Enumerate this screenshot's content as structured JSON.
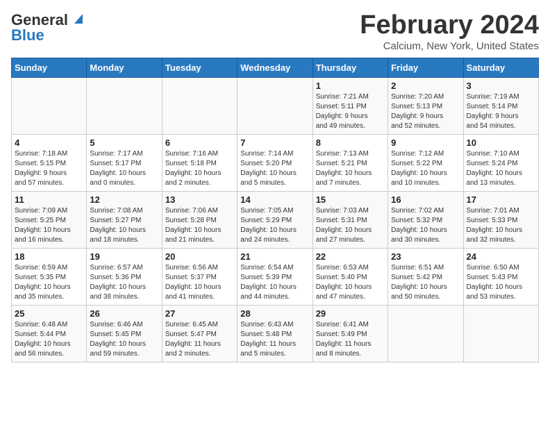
{
  "logo": {
    "general": "General",
    "blue": "Blue"
  },
  "header": {
    "title": "February 2024",
    "subtitle": "Calcium, New York, United States"
  },
  "days_of_week": [
    "Sunday",
    "Monday",
    "Tuesday",
    "Wednesday",
    "Thursday",
    "Friday",
    "Saturday"
  ],
  "weeks": [
    [
      {
        "day": "",
        "info": ""
      },
      {
        "day": "",
        "info": ""
      },
      {
        "day": "",
        "info": ""
      },
      {
        "day": "",
        "info": ""
      },
      {
        "day": "1",
        "info": "Sunrise: 7:21 AM\nSunset: 5:11 PM\nDaylight: 9 hours\nand 49 minutes."
      },
      {
        "day": "2",
        "info": "Sunrise: 7:20 AM\nSunset: 5:13 PM\nDaylight: 9 hours\nand 52 minutes."
      },
      {
        "day": "3",
        "info": "Sunrise: 7:19 AM\nSunset: 5:14 PM\nDaylight: 9 hours\nand 54 minutes."
      }
    ],
    [
      {
        "day": "4",
        "info": "Sunrise: 7:18 AM\nSunset: 5:15 PM\nDaylight: 9 hours\nand 57 minutes."
      },
      {
        "day": "5",
        "info": "Sunrise: 7:17 AM\nSunset: 5:17 PM\nDaylight: 10 hours\nand 0 minutes."
      },
      {
        "day": "6",
        "info": "Sunrise: 7:16 AM\nSunset: 5:18 PM\nDaylight: 10 hours\nand 2 minutes."
      },
      {
        "day": "7",
        "info": "Sunrise: 7:14 AM\nSunset: 5:20 PM\nDaylight: 10 hours\nand 5 minutes."
      },
      {
        "day": "8",
        "info": "Sunrise: 7:13 AM\nSunset: 5:21 PM\nDaylight: 10 hours\nand 7 minutes."
      },
      {
        "day": "9",
        "info": "Sunrise: 7:12 AM\nSunset: 5:22 PM\nDaylight: 10 hours\nand 10 minutes."
      },
      {
        "day": "10",
        "info": "Sunrise: 7:10 AM\nSunset: 5:24 PM\nDaylight: 10 hours\nand 13 minutes."
      }
    ],
    [
      {
        "day": "11",
        "info": "Sunrise: 7:09 AM\nSunset: 5:25 PM\nDaylight: 10 hours\nand 16 minutes."
      },
      {
        "day": "12",
        "info": "Sunrise: 7:08 AM\nSunset: 5:27 PM\nDaylight: 10 hours\nand 18 minutes."
      },
      {
        "day": "13",
        "info": "Sunrise: 7:06 AM\nSunset: 5:28 PM\nDaylight: 10 hours\nand 21 minutes."
      },
      {
        "day": "14",
        "info": "Sunrise: 7:05 AM\nSunset: 5:29 PM\nDaylight: 10 hours\nand 24 minutes."
      },
      {
        "day": "15",
        "info": "Sunrise: 7:03 AM\nSunset: 5:31 PM\nDaylight: 10 hours\nand 27 minutes."
      },
      {
        "day": "16",
        "info": "Sunrise: 7:02 AM\nSunset: 5:32 PM\nDaylight: 10 hours\nand 30 minutes."
      },
      {
        "day": "17",
        "info": "Sunrise: 7:01 AM\nSunset: 5:33 PM\nDaylight: 10 hours\nand 32 minutes."
      }
    ],
    [
      {
        "day": "18",
        "info": "Sunrise: 6:59 AM\nSunset: 5:35 PM\nDaylight: 10 hours\nand 35 minutes."
      },
      {
        "day": "19",
        "info": "Sunrise: 6:57 AM\nSunset: 5:36 PM\nDaylight: 10 hours\nand 38 minutes."
      },
      {
        "day": "20",
        "info": "Sunrise: 6:56 AM\nSunset: 5:37 PM\nDaylight: 10 hours\nand 41 minutes."
      },
      {
        "day": "21",
        "info": "Sunrise: 6:54 AM\nSunset: 5:39 PM\nDaylight: 10 hours\nand 44 minutes."
      },
      {
        "day": "22",
        "info": "Sunrise: 6:53 AM\nSunset: 5:40 PM\nDaylight: 10 hours\nand 47 minutes."
      },
      {
        "day": "23",
        "info": "Sunrise: 6:51 AM\nSunset: 5:42 PM\nDaylight: 10 hours\nand 50 minutes."
      },
      {
        "day": "24",
        "info": "Sunrise: 6:50 AM\nSunset: 5:43 PM\nDaylight: 10 hours\nand 53 minutes."
      }
    ],
    [
      {
        "day": "25",
        "info": "Sunrise: 6:48 AM\nSunset: 5:44 PM\nDaylight: 10 hours\nand 56 minutes."
      },
      {
        "day": "26",
        "info": "Sunrise: 6:46 AM\nSunset: 5:45 PM\nDaylight: 10 hours\nand 59 minutes."
      },
      {
        "day": "27",
        "info": "Sunrise: 6:45 AM\nSunset: 5:47 PM\nDaylight: 11 hours\nand 2 minutes."
      },
      {
        "day": "28",
        "info": "Sunrise: 6:43 AM\nSunset: 5:48 PM\nDaylight: 11 hours\nand 5 minutes."
      },
      {
        "day": "29",
        "info": "Sunrise: 6:41 AM\nSunset: 5:49 PM\nDaylight: 11 hours\nand 8 minutes."
      },
      {
        "day": "",
        "info": ""
      },
      {
        "day": "",
        "info": ""
      }
    ]
  ]
}
